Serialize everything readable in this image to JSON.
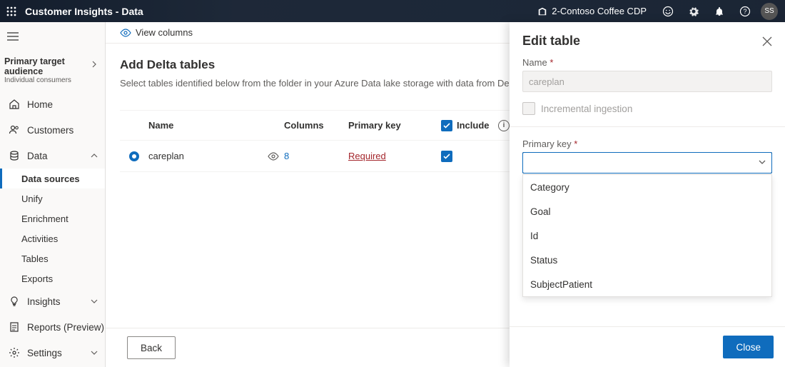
{
  "header": {
    "app_title": "Customer Insights - Data",
    "environment": "2-Contoso Coffee CDP",
    "avatar_initials": "SS"
  },
  "sidebar": {
    "audience_label": "Primary target audience",
    "audience_value": "Individual consumers",
    "items": [
      {
        "label": "Home",
        "icon": "home"
      },
      {
        "label": "Customers",
        "icon": "people"
      },
      {
        "label": "Data",
        "icon": "database",
        "expanded": true
      },
      {
        "label": "Insights",
        "icon": "lightbulb",
        "expandable": true
      },
      {
        "label": "Reports (Preview)",
        "icon": "report"
      },
      {
        "label": "Settings",
        "icon": "gear",
        "expandable": true
      }
    ],
    "data_subitems": [
      {
        "label": "Data sources",
        "active": true
      },
      {
        "label": "Unify"
      },
      {
        "label": "Enrichment"
      },
      {
        "label": "Activities"
      },
      {
        "label": "Tables"
      },
      {
        "label": "Exports"
      }
    ]
  },
  "toolbar": {
    "view_columns": "View columns"
  },
  "page": {
    "title": "Add Delta tables",
    "subtitle": "Select tables identified below from the folder in your Azure Data lake storage with data from Delta tables.",
    "columns": {
      "name": "Name",
      "columns": "Columns",
      "primary_key": "Primary key",
      "include": "Include"
    },
    "rows": [
      {
        "name": "careplan",
        "columns": "8",
        "primary_key": "Required",
        "included": true,
        "selected": true
      }
    ],
    "back_label": "Back"
  },
  "panel": {
    "title": "Edit table",
    "name_label": "Name",
    "name_value": "careplan",
    "incremental_label": "Incremental ingestion",
    "primary_key_label": "Primary key",
    "primary_key_value": "",
    "options": [
      "Category",
      "Goal",
      "Id",
      "Status",
      "SubjectPatient"
    ],
    "close_label": "Close"
  }
}
